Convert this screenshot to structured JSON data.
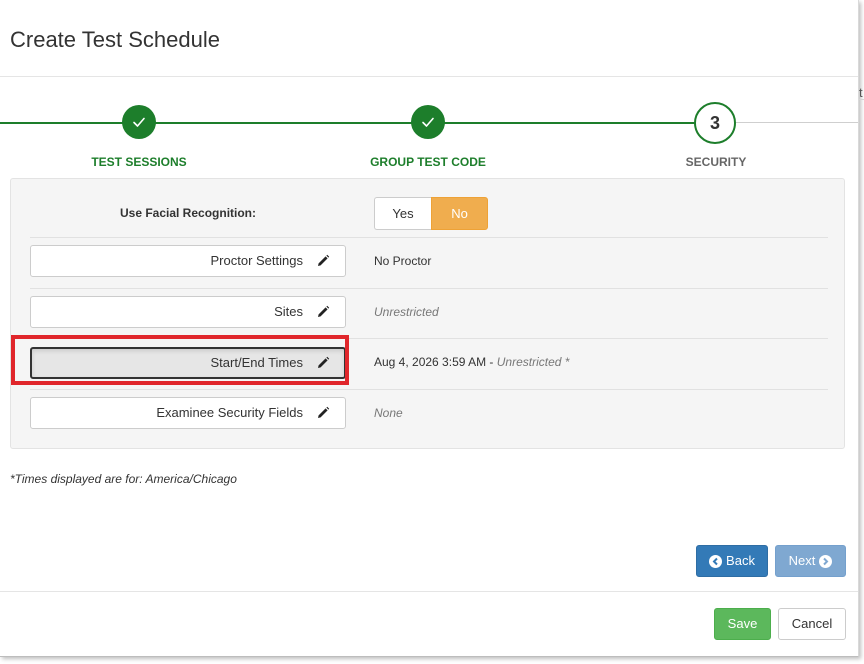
{
  "modal": {
    "title": "Create Test Schedule"
  },
  "colors": {
    "step_done": "#1d7e2b",
    "toggle_selected": "#f0ad4e",
    "back_button": "#337ab7",
    "next_button": "#7fa8d1",
    "save_button": "#5cb85c",
    "highlight_box": "#e0262b"
  },
  "stepper": {
    "steps": [
      {
        "label": "TEST SESSIONS",
        "state": "done",
        "icon": "check-icon"
      },
      {
        "label": "GROUP TEST CODE",
        "state": "done",
        "icon": "check-icon"
      },
      {
        "label": "SECURITY",
        "state": "current",
        "number": "3"
      }
    ]
  },
  "security": {
    "facial_recognition": {
      "label": "Use Facial Recognition:",
      "options": [
        "Yes",
        "No"
      ],
      "selected": "No"
    },
    "proctor": {
      "button_label": "Proctor Settings",
      "value": "No Proctor",
      "icon": "pencil-icon"
    },
    "sites": {
      "button_label": "Sites",
      "value": "Unrestricted",
      "icon": "pencil-icon"
    },
    "times": {
      "button_label": "Start/End Times",
      "value_date": "Aug 4, 2026 3:59 AM",
      "value_separator": " - ",
      "value_restriction": "Unrestricted *",
      "icon": "pencil-icon"
    },
    "examinee_fields": {
      "button_label": "Examinee Security Fields",
      "value": "None",
      "icon": "pencil-icon"
    }
  },
  "footnote": "*Times displayed are for: America/Chicago",
  "navigation": {
    "back_label": "Back",
    "next_label": "Next"
  },
  "footer": {
    "save_label": "Save",
    "cancel_label": "Cancel"
  },
  "edge_glyph": "t"
}
